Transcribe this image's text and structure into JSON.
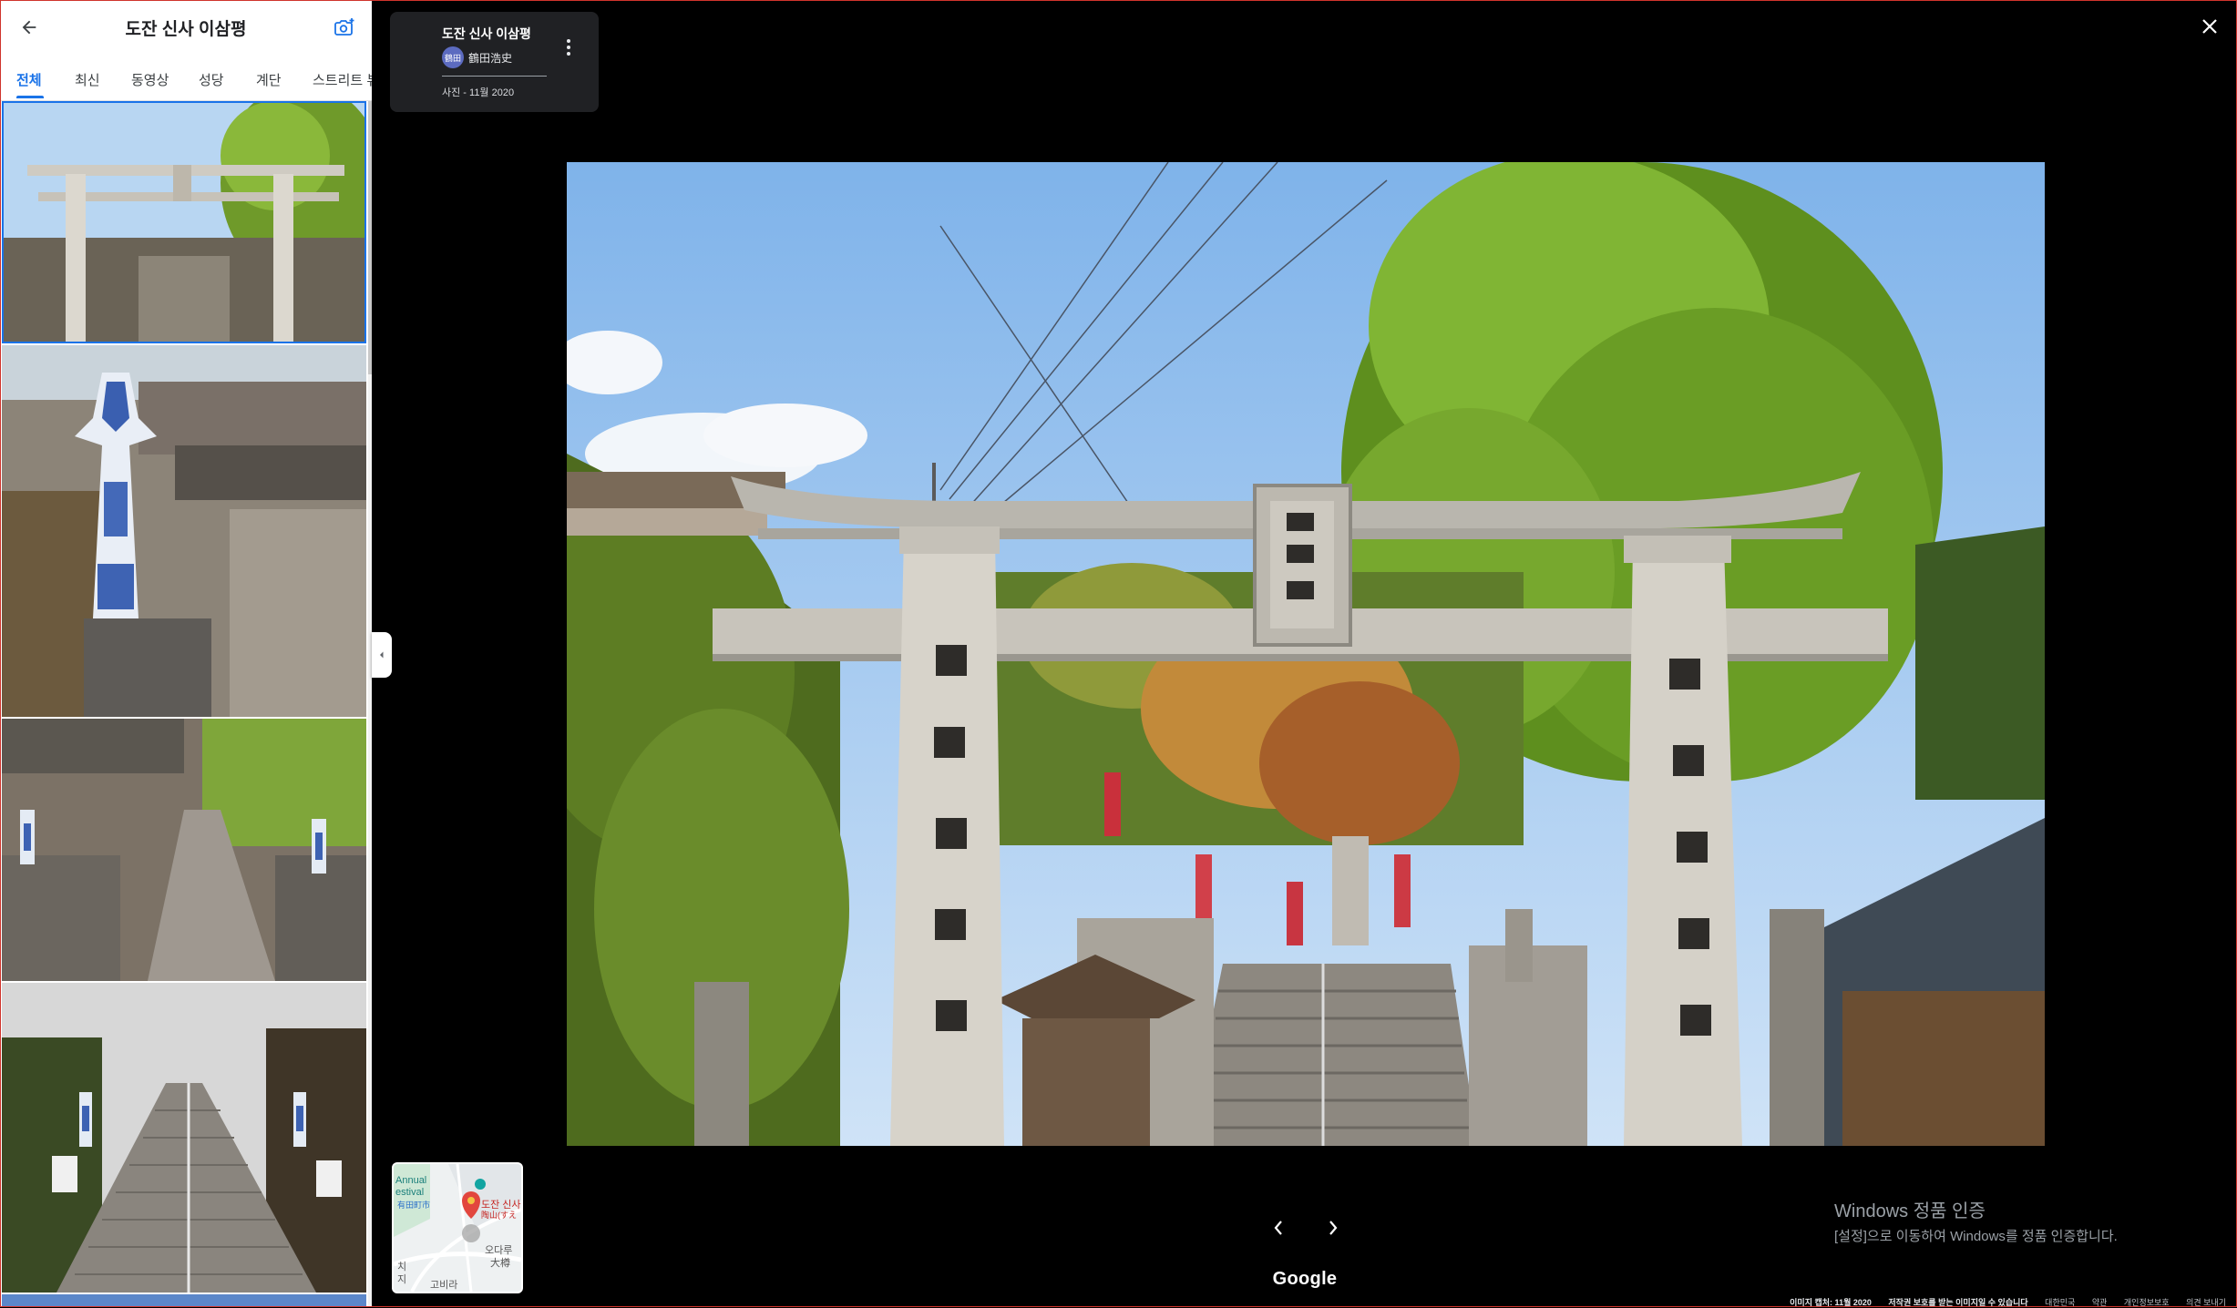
{
  "panel": {
    "title": "도잔 신사 이삼평",
    "tabs": [
      "전체",
      "최신",
      "동영상",
      "성당",
      "계단",
      "스트리트 뷰"
    ],
    "active_tab": 0
  },
  "info": {
    "title": "도잔 신사 이삼평",
    "avatar_text": "鶴田",
    "author": "鶴田浩史",
    "date": "사진 - 11월 2020"
  },
  "minimap": {
    "label_festival_1": "Annual",
    "label_festival_2": "estival",
    "label_city": "有田町市",
    "pin_label_1": "도잔 신사",
    "pin_label_2": "陶山(すえ",
    "label_odaru_1": "오다루",
    "label_odaru_2": "大樽",
    "label_left": "치",
    "label_left2": "지",
    "label_bottom": "고비라"
  },
  "viewer": {
    "google": "Google"
  },
  "watermark": {
    "line1": "Windows 정품 인증",
    "line2": "[설정]으로 이동하여 Windows를 정품 인증합니다."
  },
  "footer": {
    "items": [
      "이미지 캡처: 11월 2020",
      "저작권 보호를 받는 이미지일 수 있습니다",
      "대한민국",
      "약관",
      "개인정보보호",
      "의견 보내기"
    ]
  },
  "colors": {
    "accent": "#1a73e8",
    "card": "#202124",
    "background": "#000000"
  }
}
